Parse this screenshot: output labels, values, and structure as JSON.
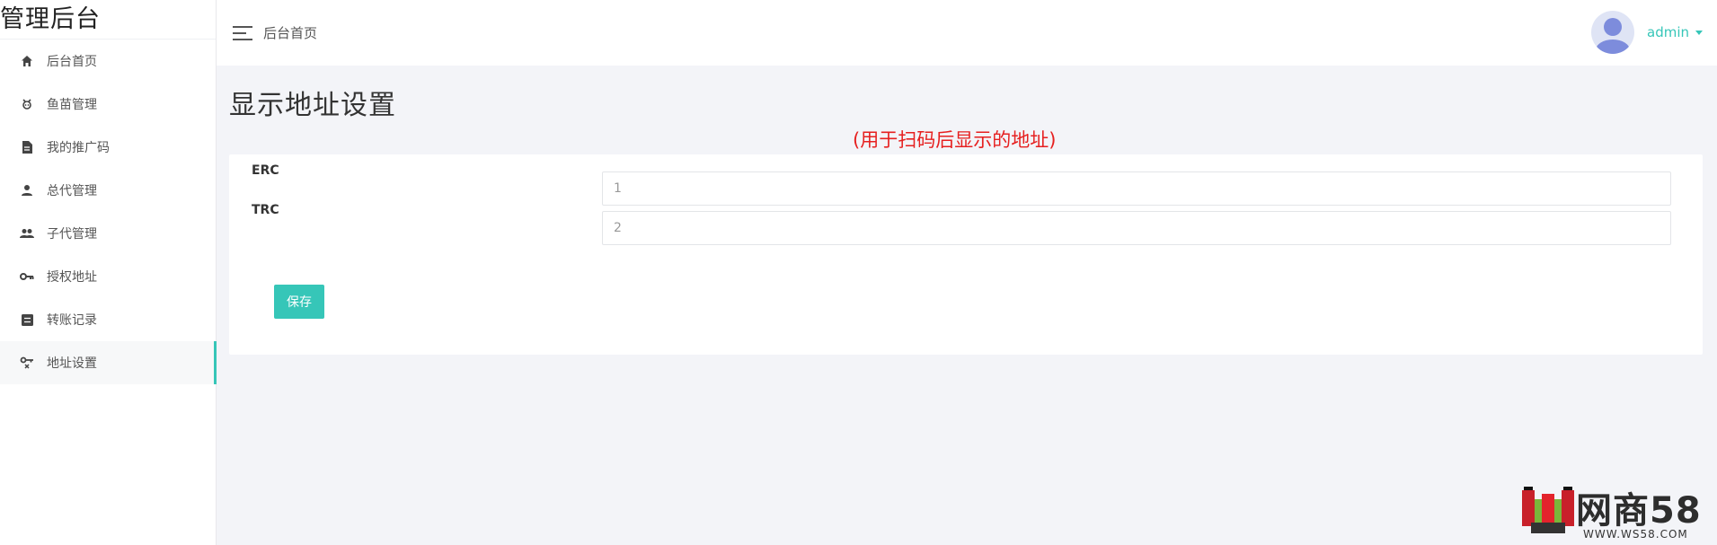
{
  "sidebar": {
    "brand": "管理后台",
    "items": [
      {
        "label": "后台首页",
        "icon": "home-icon"
      },
      {
        "label": "鱼苗管理",
        "icon": "fish-icon"
      },
      {
        "label": "我的推广码",
        "icon": "document-icon"
      },
      {
        "label": "总代管理",
        "icon": "person-icon"
      },
      {
        "label": "子代管理",
        "icon": "group-icon"
      },
      {
        "label": "授权地址",
        "icon": "key-icon"
      },
      {
        "label": "转账记录",
        "icon": "list-icon"
      },
      {
        "label": "地址设置",
        "icon": "key-settings-icon",
        "active": true
      }
    ]
  },
  "header": {
    "breadcrumb": "后台首页",
    "username": "admin"
  },
  "main": {
    "title": "显示地址设置",
    "hint": "(用于扫码后显示的地址)",
    "fields": [
      {
        "label": "ERC",
        "value": "1"
      },
      {
        "label": "TRC",
        "value": "2"
      }
    ],
    "save_label": "保存"
  },
  "watermark": {
    "text": "网商58",
    "url": "WWW.WS58.COM"
  },
  "colors": {
    "accent": "#36c6b8",
    "hint": "#e62020",
    "background": "#f3f4f8"
  }
}
